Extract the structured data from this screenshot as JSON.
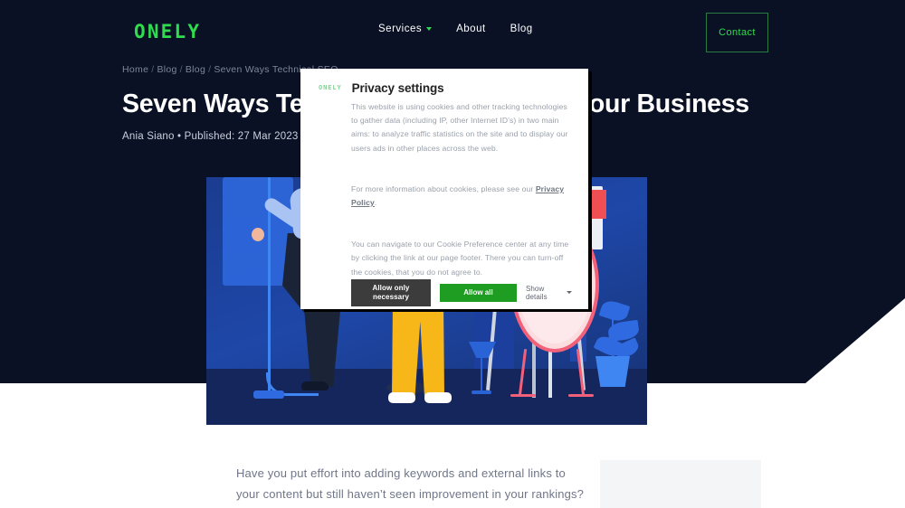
{
  "site": {
    "logo_text": "ONELY",
    "logo_color": "#2fdb4f"
  },
  "nav": {
    "items": [
      {
        "label": "Services",
        "has_dropdown": true
      },
      {
        "label": "About",
        "has_dropdown": false
      },
      {
        "label": "Blog",
        "has_dropdown": false
      }
    ],
    "contact_label": "Contact"
  },
  "breadcrumb": {
    "items": [
      "Home",
      "Blog",
      "Blog",
      "Seven Ways Technical SEO"
    ],
    "separator": "/"
  },
  "hero": {
    "title": "Seven Ways Technical SEO Can Help Your Business",
    "author": "Ania Siano",
    "bullet": "•",
    "published_label": "Published:",
    "published_date": "27 Mar 2023",
    "meta_line": "Ania Siano • Published: 27 Mar 2023"
  },
  "article": {
    "intro": "Have you put effort into adding keywords and external links to your content but still haven’t seen improvement in your rankings?"
  },
  "modal": {
    "logo_text": "ONELY",
    "title": "Privacy settings",
    "paragraph_1": "This website is using cookies and other tracking technologies to gather data (including IP, other Internet ID’s) in two main aims: to analyze traffic statistics on the site and to display our users ads in other places across the web.",
    "paragraph_2_prefix": "For more information about cookies, please see our ",
    "privacy_policy_link": "Privacy Policy",
    "paragraph_2_suffix": ".",
    "paragraph_3": "You can navigate to our Cookie Preference center at any time by clicking the link at our page footer. There you can turn-off the cookies, that you do not agree to.",
    "btn_necessary": "Allow only necessary",
    "btn_allow_all": "Allow all",
    "show_details": "Show details",
    "colors": {
      "allow_all": "#1f9c22",
      "necessary": "#3c3c3c"
    }
  },
  "theme": {
    "hero_background": "#0a1124",
    "accent_green": "#2fdb4f",
    "page_background": "#ffffff"
  }
}
